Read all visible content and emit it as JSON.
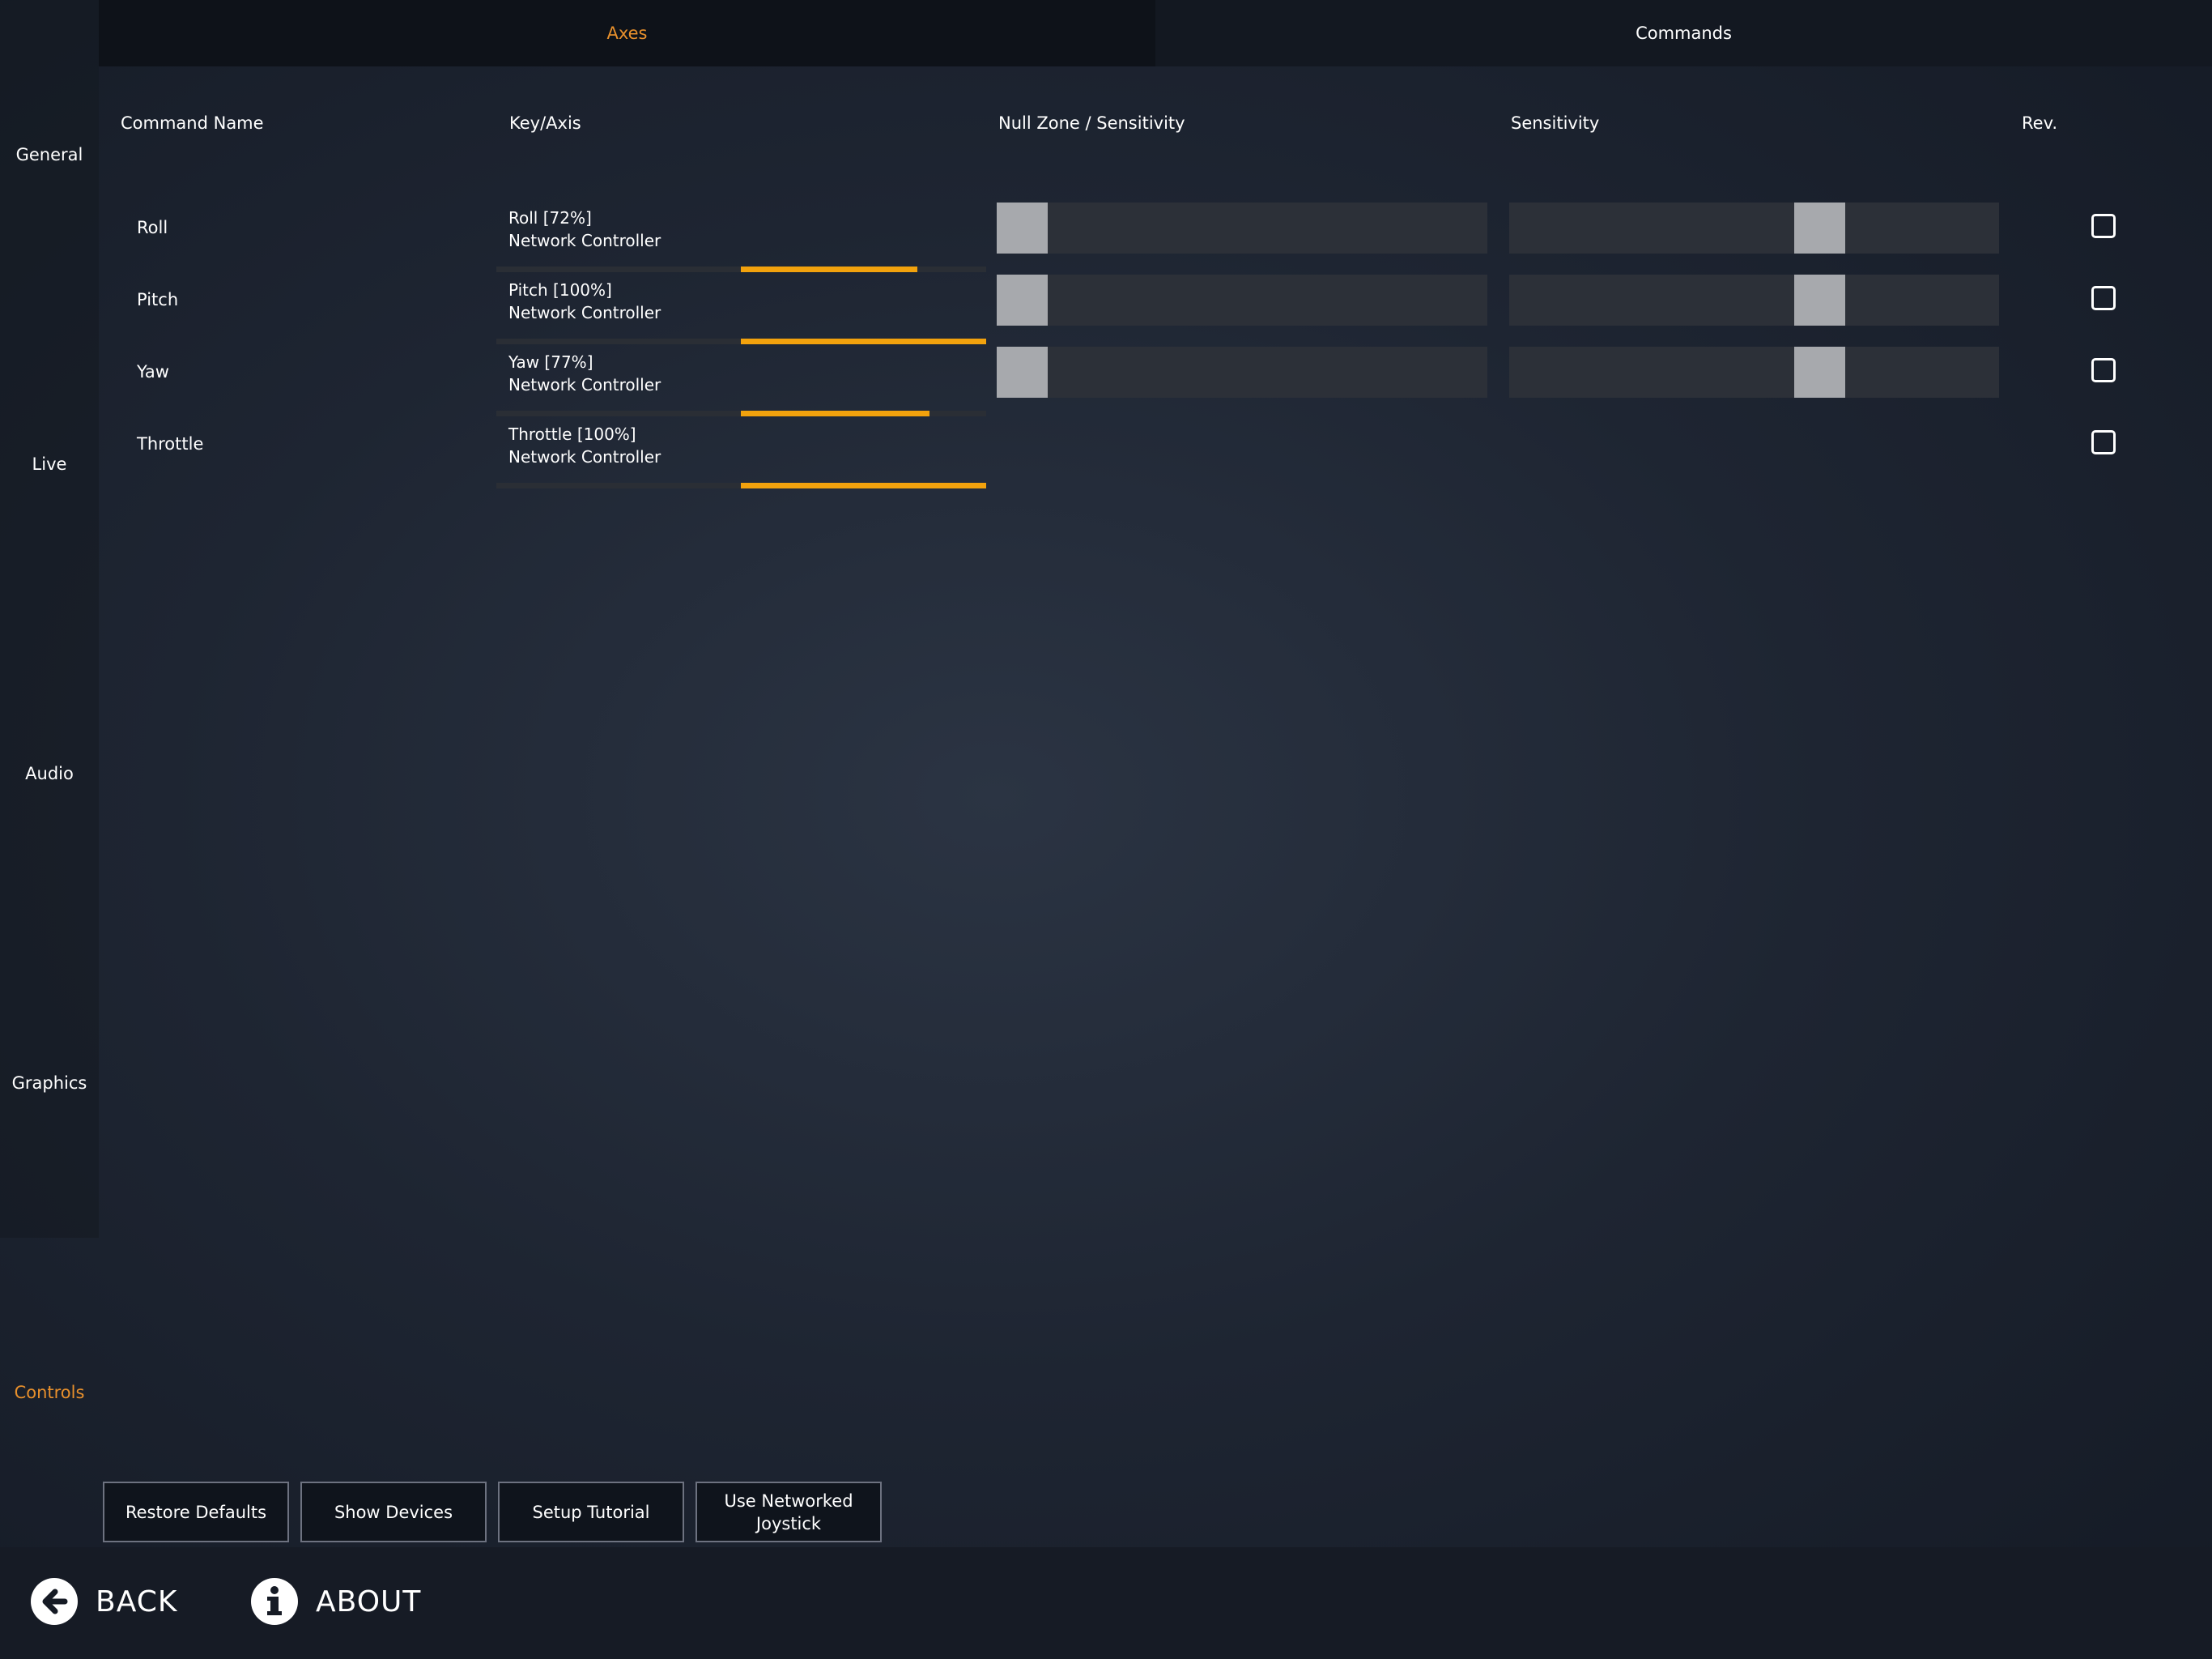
{
  "sidebar": {
    "items": [
      {
        "label": "General",
        "active": false
      },
      {
        "label": "Live",
        "active": false
      },
      {
        "label": "Audio",
        "active": false
      },
      {
        "label": "Graphics",
        "active": false
      },
      {
        "label": "Controls",
        "active": true
      }
    ]
  },
  "tabs": [
    {
      "label": "Axes",
      "active": true
    },
    {
      "label": "Commands",
      "active": false
    }
  ],
  "columns": {
    "command_name": "Command Name",
    "key_axis": "Key/Axis",
    "null_zone": "Null Zone / Sensitivity",
    "sensitivity": "Sensitivity",
    "rev": "Rev."
  },
  "rows": [
    {
      "name": "Roll",
      "axis": "Roll [72%]",
      "device": "Network Controller",
      "level": 0.72,
      "null_zone": 0.0,
      "sensitivity": 0.65,
      "reversed": false
    },
    {
      "name": "Pitch",
      "axis": "Pitch [100%]",
      "device": "Network Controller",
      "level": 1.0,
      "null_zone": 0.0,
      "sensitivity": 0.65,
      "reversed": false
    },
    {
      "name": "Yaw",
      "axis": "Yaw [77%]",
      "device": "Network Controller",
      "level": 0.77,
      "null_zone": 0.0,
      "sensitivity": 0.65,
      "reversed": false
    },
    {
      "name": "Throttle",
      "axis": "Throttle [100%]",
      "device": "Network Controller",
      "level": 1.0,
      "reversed": false
    }
  ],
  "buttons": {
    "restore": "Restore Defaults",
    "show_devices": "Show Devices",
    "setup_tutorial": "Setup Tutorial",
    "networked_joystick": "Use Networked\nJoystick"
  },
  "footer": {
    "back": "BACK",
    "about": "ABOUT",
    "back_icon": "arrow-left-circle-icon",
    "about_icon": "info-circle-icon"
  },
  "colors": {
    "accent": "#e8902c",
    "meter": "#f2a20d"
  }
}
